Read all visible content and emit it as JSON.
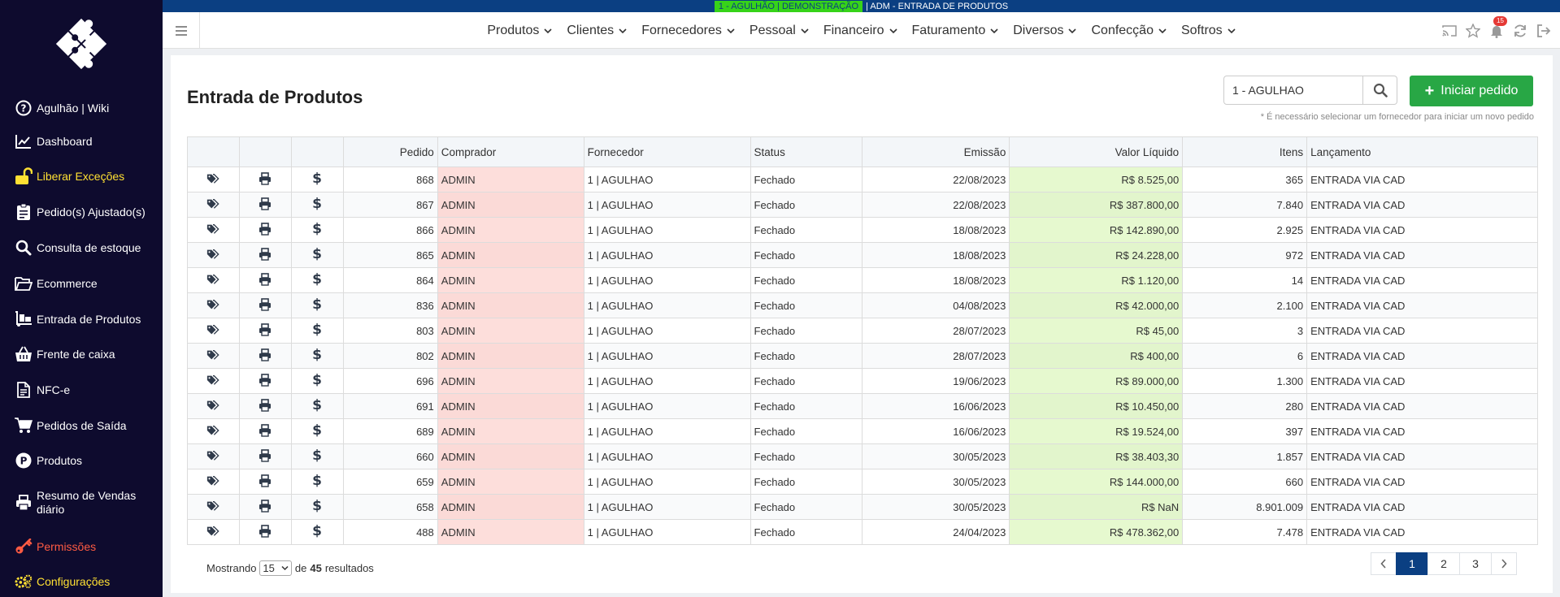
{
  "topstrip": {
    "company": "1 - AGULHÃO | DEMONSTRAÇÃO",
    "context": "| ADM - ENTRADA DE PRODUTOS"
  },
  "sidebar": {
    "items": [
      {
        "label": "Agulhão | Wiki",
        "icon": "question-circle-icon"
      },
      {
        "label": "Dashboard",
        "icon": "chart-line-icon"
      },
      {
        "label": "Liberar Exceções",
        "icon": "unlock-icon"
      },
      {
        "label": "Pedido(s) Ajustado(s)",
        "icon": "clipboard-icon"
      },
      {
        "label": "Consulta de estoque",
        "icon": "search-icon"
      },
      {
        "label": "Ecommerce",
        "icon": "folder-open-icon"
      },
      {
        "label": "Entrada de Produtos",
        "icon": "dolly-icon"
      },
      {
        "label": "Frente de caixa",
        "icon": "basket-icon"
      },
      {
        "label": "NFC-e",
        "icon": "file-icon"
      },
      {
        "label": "Pedidos de Saída",
        "icon": "cart-icon"
      },
      {
        "label": "Produtos",
        "icon": "product-p-icon"
      },
      {
        "label_line1": "Resumo de Vendas",
        "label_line2": "diário",
        "icon": "printer-icon"
      },
      {
        "label": "Permissões",
        "icon": "key-icon"
      },
      {
        "label": "Configurações",
        "icon": "cogs-icon"
      }
    ]
  },
  "navbar": {
    "menu": [
      "Produtos",
      "Clientes",
      "Fornecedores",
      "Pessoal",
      "Financeiro",
      "Faturamento",
      "Diversos",
      "Confecção",
      "Softros"
    ],
    "notification_count": "15"
  },
  "page": {
    "title": "Entrada de Produtos",
    "supplier_value": "1 -  AGULHAO",
    "start_button": "Iniciar pedido",
    "hint": "* É necessário selecionar um fornecedor para iniciar um novo pedido"
  },
  "table": {
    "headers": [
      "Pedido",
      "Comprador",
      "Fornecedor",
      "Status",
      "Emissão",
      "Valor Líquido",
      "Itens",
      "Lançamento"
    ],
    "rows": [
      [
        "868",
        "ADMIN",
        "1 | AGULHAO",
        "Fechado",
        "22/08/2023",
        "R$ 8.525,00",
        "365",
        "ENTRADA VIA CAD"
      ],
      [
        "867",
        "ADMIN",
        "1 | AGULHAO",
        "Fechado",
        "22/08/2023",
        "R$ 387.800,00",
        "7.840",
        "ENTRADA VIA CAD"
      ],
      [
        "866",
        "ADMIN",
        "1 | AGULHAO",
        "Fechado",
        "18/08/2023",
        "R$ 142.890,00",
        "2.925",
        "ENTRADA VIA CAD"
      ],
      [
        "865",
        "ADMIN",
        "1 | AGULHAO",
        "Fechado",
        "18/08/2023",
        "R$ 24.228,00",
        "972",
        "ENTRADA VIA CAD"
      ],
      [
        "864",
        "ADMIN",
        "1 | AGULHAO",
        "Fechado",
        "18/08/2023",
        "R$ 1.120,00",
        "14",
        "ENTRADA VIA CAD"
      ],
      [
        "836",
        "ADMIN",
        "1 | AGULHAO",
        "Fechado",
        "04/08/2023",
        "R$ 42.000,00",
        "2.100",
        "ENTRADA VIA CAD"
      ],
      [
        "803",
        "ADMIN",
        "1 | AGULHAO",
        "Fechado",
        "28/07/2023",
        "R$ 45,00",
        "3",
        "ENTRADA VIA CAD"
      ],
      [
        "802",
        "ADMIN",
        "1 | AGULHAO",
        "Fechado",
        "28/07/2023",
        "R$ 400,00",
        "6",
        "ENTRADA VIA CAD"
      ],
      [
        "696",
        "ADMIN",
        "1 | AGULHAO",
        "Fechado",
        "19/06/2023",
        "R$ 89.000,00",
        "1.300",
        "ENTRADA VIA CAD"
      ],
      [
        "691",
        "ADMIN",
        "1 | AGULHAO",
        "Fechado",
        "16/06/2023",
        "R$ 10.450,00",
        "280",
        "ENTRADA VIA CAD"
      ],
      [
        "689",
        "ADMIN",
        "1 | AGULHAO",
        "Fechado",
        "16/06/2023",
        "R$ 19.524,00",
        "397",
        "ENTRADA VIA CAD"
      ],
      [
        "660",
        "ADMIN",
        "1 | AGULHAO",
        "Fechado",
        "30/05/2023",
        "R$ 38.403,30",
        "1.857",
        "ENTRADA VIA CAD"
      ],
      [
        "659",
        "ADMIN",
        "1 | AGULHAO",
        "Fechado",
        "30/05/2023",
        "R$ 144.000,00",
        "660",
        "ENTRADA VIA CAD"
      ],
      [
        "658",
        "ADMIN",
        "1 | AGULHAO",
        "Fechado",
        "30/05/2023",
        "R$ NaN",
        "8.901.009",
        "ENTRADA VIA CAD"
      ],
      [
        "488",
        "ADMIN",
        "1 | AGULHAO",
        "Fechado",
        "24/04/2023",
        "R$ 478.362,00",
        "7.478",
        "ENTRADA VIA CAD"
      ]
    ]
  },
  "footer": {
    "showing": "Mostrando",
    "page_size": "15",
    "of": "de",
    "total": "45",
    "results": "resultados",
    "pages": [
      "1",
      "2",
      "3"
    ],
    "active_page": "1"
  },
  "colors": {
    "sidebar_bg": "#0e0b2e",
    "accent_blue": "#0b3f82",
    "green_button": "#28a745",
    "buyer_cell": "#fddedb",
    "value_cell": "#e6f9cf"
  }
}
